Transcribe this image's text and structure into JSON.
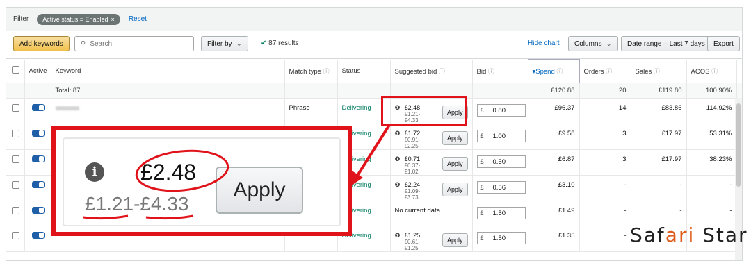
{
  "filter": {
    "label": "Filter",
    "active_pill": "Active status = Enabled",
    "reset": "Reset"
  },
  "toolbar": {
    "add_keywords": "Add keywords",
    "search_placeholder": "Search",
    "filter_by": "Filter by",
    "results": "87 results",
    "hide_chart": "Hide chart",
    "columns": "Columns",
    "date_range": "Date range – Last 7 days",
    "export": "Export"
  },
  "table": {
    "headers": [
      "Active",
      "Keyword",
      "Match type",
      "Status",
      "Suggested bid",
      "Bid",
      "Spend",
      "Orders",
      "Sales",
      "ACOS"
    ],
    "total": {
      "label": "Total: 87",
      "spend": "£120.88",
      "orders": "20",
      "sales": "£119.80",
      "acos": "100.90%"
    },
    "rows": [
      {
        "match": "Phrase",
        "status": "Delivering",
        "sb_price": "£2.48",
        "sb_range": "£1.21-£4.33",
        "apply": "Apply",
        "bid_cur": "£",
        "bid": "0.80",
        "spend": "£96.37",
        "orders": "14",
        "sales": "£83.86",
        "acos": "114.92%"
      },
      {
        "match": "",
        "status": "Delivering",
        "sb_price": "£1.72",
        "sb_range": "£0.91-£2.25",
        "apply": "Apply",
        "bid_cur": "£",
        "bid": "1.00",
        "spend": "£9.58",
        "orders": "3",
        "sales": "£17.97",
        "acos": "53.31%"
      },
      {
        "match": "",
        "status": "Delivering",
        "sb_price": "£0.71",
        "sb_range": "£0.37-£1.02",
        "apply": "Apply",
        "bid_cur": "£",
        "bid": "0.50",
        "spend": "£6.87",
        "orders": "3",
        "sales": "£17.97",
        "acos": "38.23%"
      },
      {
        "match": "",
        "status": "Delivering",
        "sb_price": "£2.24",
        "sb_range": "£1.09-£3.73",
        "apply": "Apply",
        "bid_cur": "£",
        "bid": "0.56",
        "spend": "£3.10",
        "orders": "-",
        "sales": "-",
        "acos": "-"
      },
      {
        "match": "",
        "status": "Delivering",
        "sb_nodata": "No current data",
        "bid_cur": "£",
        "bid": "1.50",
        "spend": "£1.49",
        "orders": "-",
        "sales": "-",
        "acos": "-"
      },
      {
        "match": "",
        "status": "Delivering",
        "sb_price": "£1.25",
        "sb_range": "£0.61-£1.25",
        "apply": "Apply",
        "bid_cur": "£",
        "bid": "1.50",
        "spend": "£1.35",
        "orders": "-",
        "sales": "",
        "acos": ""
      }
    ]
  },
  "zoom": {
    "price": "£2.48",
    "range": "£1.21-£4.33",
    "apply": "Apply"
  },
  "logo": {
    "part1": "Saf",
    "part2": "ari",
    "part3": " Star"
  },
  "colors": {
    "accent_red": "#e0131b",
    "link_blue": "#0066c0",
    "delivering_green": "#067d62"
  }
}
